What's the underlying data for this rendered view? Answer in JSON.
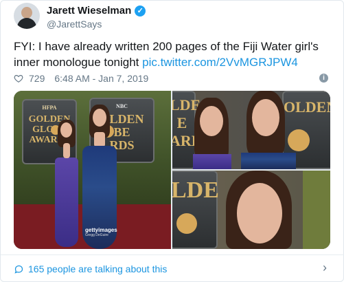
{
  "author": {
    "display_name": "Jarett Wieselman",
    "handle": "@JarettSays",
    "verified_icon": "verified-badge-icon"
  },
  "tweet": {
    "text": "FYI: I have already written 200 pages of the Fiji Water girl's inner monologue tonight ",
    "link": "pic.twitter.com/2VvMGRJPW4"
  },
  "meta": {
    "likes": "729",
    "timestamp": "6:48 AM - Jan 7, 2019"
  },
  "media": {
    "poster_left": "GOLDEN\nGLOBE\nAWARDS",
    "poster_left_small": "HFPA",
    "poster_right": "OLDEN\nBE\nRDS",
    "poster_right_small": "NBC",
    "top_right_poster": "LDE\nE\nARD",
    "bottom_left_poster": "LDE",
    "watermark": "gettyimages",
    "watermark_credit": "Gregg DeGuire"
  },
  "footer": {
    "talking": "165 people are talking about this"
  },
  "colors": {
    "link": "#1b95e0",
    "verified": "#1da1f2",
    "secondary_text": "#657786"
  }
}
